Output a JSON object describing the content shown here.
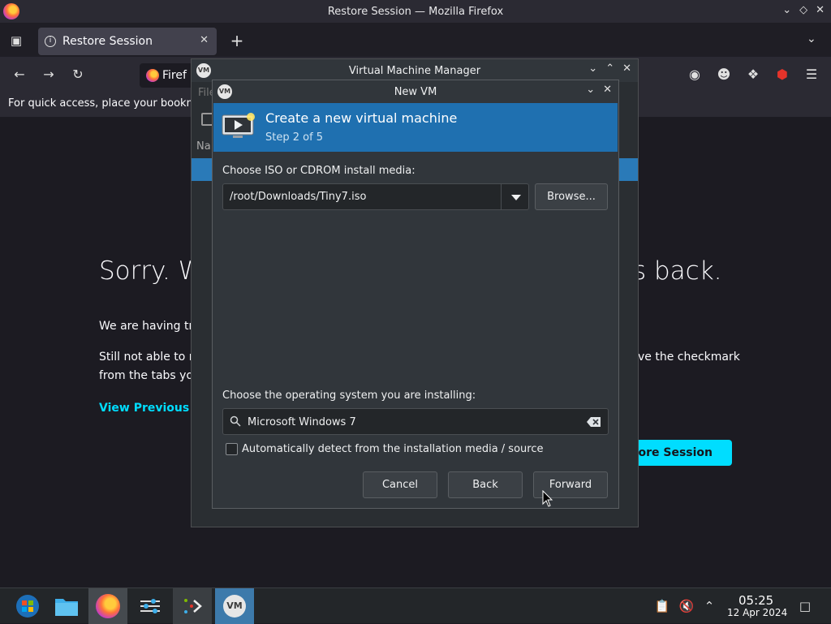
{
  "firefox": {
    "window_title": "Restore Session — Mozilla Firefox",
    "tab_title": "Restore Session",
    "url_text": "Firef",
    "bookmarks_hint": "For quick access, place your bookm"
  },
  "restore_page": {
    "heading_start": "Sorry. W",
    "heading_end": "s back.",
    "para1": "We are having tro",
    "para2_line1": "Still not able to re",
    "para2_line1_end": "ve the checkmark",
    "para2_line2": "from the tabs you",
    "view_previous": "View Previous Ta",
    "restore_button": "store Session"
  },
  "vmm": {
    "title": "Virtual Machine Manager",
    "logo_text": "VM",
    "file_menu": "File",
    "name_column": "Na"
  },
  "new_vm": {
    "title": "New VM",
    "logo_text": "VM",
    "header_title": "Create a new virtual machine",
    "header_step": "Step 2 of 5",
    "iso_label": "Choose ISO or CDROM install media:",
    "iso_value": "/root/Downloads/Tiny7.iso",
    "browse_button": "Browse...",
    "os_label": "Choose the operating system you are installing:",
    "os_value": "Microsoft Windows 7",
    "autodetect_label": "Automatically detect from the installation media / source",
    "autodetect_checked": false,
    "cancel_button": "Cancel",
    "back_button": "Back",
    "forward_button": "Forward",
    "header_color": "#1f70b0"
  },
  "taskbar": {
    "time": "05:25",
    "date": "12 Apr 2024",
    "vm_logo_text": "VM",
    "apps": [
      "start-menu-icon",
      "file-manager-icon",
      "firefox-icon",
      "settings-icon",
      "terminal-icon",
      "virt-manager-icon"
    ]
  },
  "colors": {
    "link": "#00ddff",
    "accent": "#1f70b0"
  }
}
